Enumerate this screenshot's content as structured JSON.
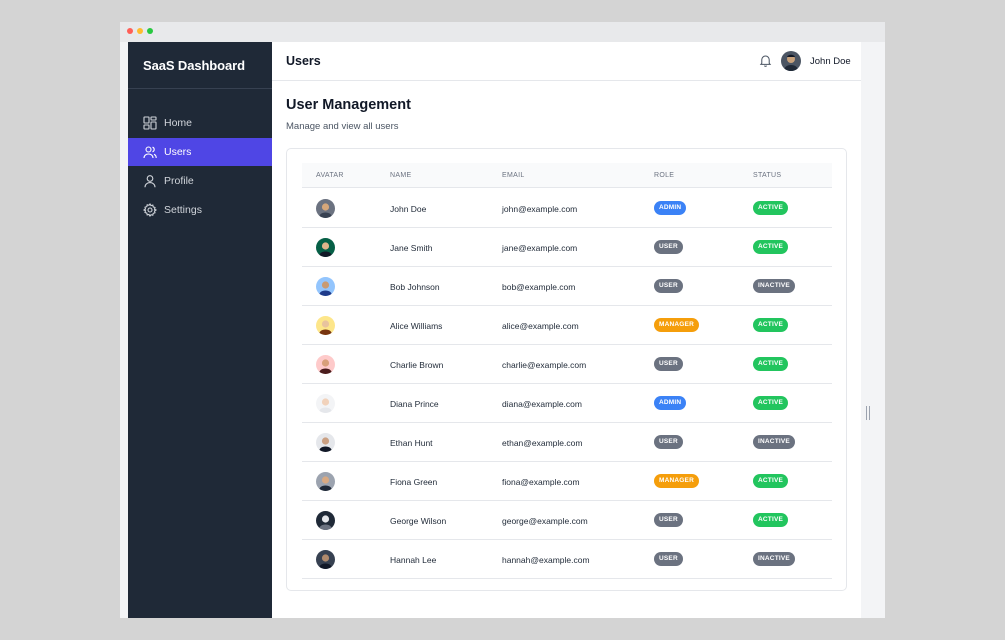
{
  "sidebar": {
    "brand": "SaaS Dashboard",
    "items": [
      {
        "label": "Home",
        "icon": "home-grid-icon"
      },
      {
        "label": "Users",
        "icon": "users-icon",
        "active": true
      },
      {
        "label": "Profile",
        "icon": "profile-icon"
      },
      {
        "label": "Settings",
        "icon": "gear-icon"
      }
    ]
  },
  "header": {
    "title": "Users",
    "user_name": "John Doe"
  },
  "page": {
    "title": "User Management",
    "subtitle": "Manage and view all users"
  },
  "table": {
    "columns": [
      "AVATAR",
      "NAME",
      "EMAIL",
      "ROLE",
      "STATUS"
    ],
    "rows": [
      {
        "name": "John Doe",
        "email": "john@example.com",
        "role": "ADMIN",
        "status": "ACTIVE"
      },
      {
        "name": "Jane Smith",
        "email": "jane@example.com",
        "role": "USER",
        "status": "ACTIVE"
      },
      {
        "name": "Bob Johnson",
        "email": "bob@example.com",
        "role": "USER",
        "status": "INACTIVE"
      },
      {
        "name": "Alice Williams",
        "email": "alice@example.com",
        "role": "MANAGER",
        "status": "ACTIVE"
      },
      {
        "name": "Charlie Brown",
        "email": "charlie@example.com",
        "role": "USER",
        "status": "ACTIVE"
      },
      {
        "name": "Diana Prince",
        "email": "diana@example.com",
        "role": "ADMIN",
        "status": "ACTIVE"
      },
      {
        "name": "Ethan Hunt",
        "email": "ethan@example.com",
        "role": "USER",
        "status": "INACTIVE"
      },
      {
        "name": "Fiona Green",
        "email": "fiona@example.com",
        "role": "MANAGER",
        "status": "ACTIVE"
      },
      {
        "name": "George Wilson",
        "email": "george@example.com",
        "role": "USER",
        "status": "ACTIVE"
      },
      {
        "name": "Hannah Lee",
        "email": "hannah@example.com",
        "role": "USER",
        "status": "INACTIVE"
      }
    ]
  },
  "colors": {
    "sidebar_bg": "#1f2937",
    "accent": "#4f46e5",
    "role": {
      "ADMIN": "#3b82f6",
      "USER": "#6b7280",
      "MANAGER": "#f59e0b"
    },
    "status": {
      "ACTIVE": "#22c55e",
      "INACTIVE": "#6b7280"
    }
  }
}
